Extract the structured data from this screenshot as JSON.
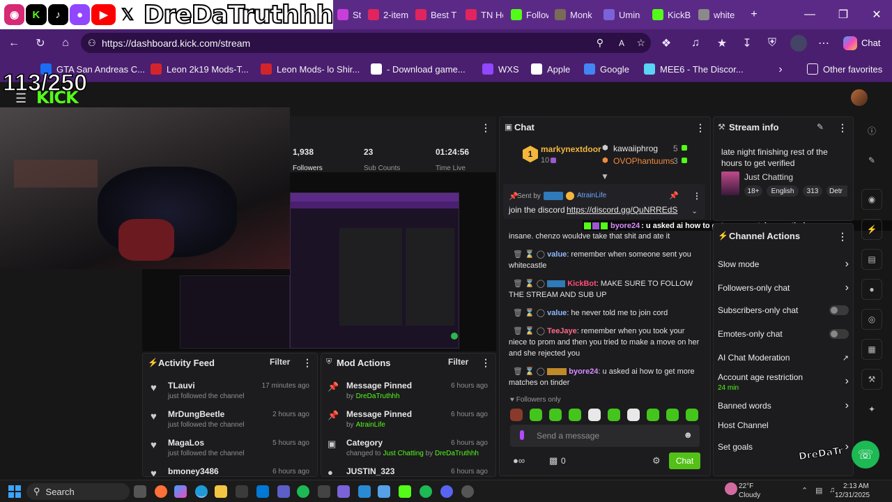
{
  "browser": {
    "tabs": [
      {
        "label": "St",
        "color": "#c73fd8"
      },
      {
        "label": "2-item",
        "color": "#e0245e"
      },
      {
        "label": "Best T",
        "color": "#e0245e"
      },
      {
        "label": "TN Ho",
        "color": "#e0245e"
      },
      {
        "label": "Follow",
        "color": "#53fc18"
      },
      {
        "label": "Monk",
        "color": "#7a6a58"
      },
      {
        "label": "Umin",
        "color": "#7b62d9"
      },
      {
        "label": "KickB",
        "color": "#53fc18"
      },
      {
        "label": "white",
        "color": "#8a8a8a"
      }
    ],
    "url": "https://dashboard.kick.com/stream",
    "chat_button": "Chat",
    "favorites": [
      {
        "label": "GTA San Andreas C...",
        "color": "#1b6ef3"
      },
      {
        "label": "Leon 2k19 Mods-T...",
        "color": "#d4242b"
      },
      {
        "label": "Leon Mods- lo Shir...",
        "color": "#d4242b"
      },
      {
        "label": "- Download game...",
        "color": "#ffffff"
      },
      {
        "label": "WXS",
        "color": "#9146ff"
      },
      {
        "label": "Apple",
        "color": "#ffffff"
      },
      {
        "label": "Google",
        "color": "#4285f4"
      },
      {
        "label": "MEE6 - The Discor...",
        "color": "#59d4f4"
      }
    ],
    "other_favorites": "Other favorites"
  },
  "overlay": {
    "brand": "DreDaTruthhh",
    "counter": "113/250",
    "logo": "KICK",
    "watermark": "DreDaTruthhh"
  },
  "stats": {
    "followers_value": "1,938",
    "followers_label": "Followers",
    "subs_value": "23",
    "subs_label": "Sub Counts",
    "time_value": "01:24:56",
    "time_label": "Time Live"
  },
  "chat": {
    "title": "Chat",
    "leaderboard": [
      {
        "name": "markynextdoor",
        "count": "10"
      },
      {
        "name": "kawaiiphrog",
        "count": "5"
      },
      {
        "name": "OVOPhantuums",
        "count": "3"
      }
    ],
    "pinned_sent_by": "Sent by",
    "pinned_author": "AtrainLife",
    "pinned_text": "join the discord",
    "pinned_link": "https://discord.gg/QuNRREdS",
    "float_user": "byore24",
    "float_msg": ": u asked ai how to get more matches on tinder",
    "messages": [
      {
        "user": "",
        "text": "insane. chenzo wouldve take that shit and ate it",
        "color": "#e4e4e4"
      },
      {
        "user": "value",
        "text": ": remember when someone sent you whitecastle",
        "color": "#8fb8ff"
      },
      {
        "user": "KickBot",
        "text": ": MAKE SURE TO FOLLOW THE STREAM AND SUB UP",
        "color": "#ff4d7a"
      },
      {
        "user": "value",
        "text": ": he never told me to join cord",
        "color": "#8fb8ff"
      },
      {
        "user": "TeeJaye",
        "text": ": remember when you took your niece to prom and then you tried to make a move on her and she rejected you",
        "color": "#ff6a8a"
      },
      {
        "user": "byore24",
        "text": ": u asked ai how to get more matches on tinder",
        "color": "#d98cff"
      }
    ],
    "mode_label": "Followers only",
    "input_placeholder": "Send a message",
    "points": "0",
    "send_button": "Chat"
  },
  "stream_info": {
    "title": "Stream info",
    "stream_title": "late night finishing rest of the hours to get verified",
    "category": "Just Chatting",
    "tags": [
      "18+",
      "English",
      "313",
      "Detr"
    ]
  },
  "channel_actions": {
    "title": "Channel Actions",
    "items": [
      {
        "label": "Slow mode",
        "control": "chevron"
      },
      {
        "label": "Followers-only chat",
        "control": "chevron"
      },
      {
        "label": "Subscribers-only chat",
        "control": "toggle"
      },
      {
        "label": "Emotes-only chat",
        "control": "toggle"
      },
      {
        "label": "AI Chat Moderation",
        "control": "external"
      },
      {
        "label": "Account age restriction",
        "control": "chevron",
        "sub": "24 min"
      },
      {
        "label": "Banned words",
        "control": "chevron"
      },
      {
        "label": "Host Channel",
        "control": "none"
      },
      {
        "label": "Set goals",
        "control": "chevron"
      }
    ]
  },
  "activity_feed": {
    "title": "Activity Feed",
    "filter": "Filter",
    "items": [
      {
        "name": "TLauvi",
        "sub": "just followed the channel",
        "time": "17 minutes ago"
      },
      {
        "name": "MrDungBeetle",
        "sub": "just followed the channel",
        "time": "2 hours ago"
      },
      {
        "name": "MagaLos",
        "sub": "just followed the channel",
        "time": "5 hours ago"
      },
      {
        "name": "bmoney3486",
        "sub": "",
        "time": "6 hours ago"
      }
    ]
  },
  "mod_actions": {
    "title": "Mod Actions",
    "filter": "Filter",
    "items": [
      {
        "title": "Message Pinned",
        "by": "by",
        "user": "DreDaTruthhh",
        "time": "6 hours ago",
        "icon": "pin"
      },
      {
        "title": "Message Pinned",
        "by": "by",
        "user": "AtrainLife",
        "time": "6 hours ago",
        "icon": "pin"
      },
      {
        "title": "Category",
        "by": "changed to",
        "user": "Just Chatting",
        "user2": "DreDaTruthhh",
        "time": "6 hours ago",
        "icon": "category"
      },
      {
        "title": "JUSTIN_323",
        "by": "",
        "user": "",
        "time": "6 hours ago",
        "icon": "user"
      }
    ]
  },
  "taskbar": {
    "search": "Search",
    "weather_temp": "22°F",
    "weather_desc": "Cloudy",
    "time": "2:13 AM",
    "date": "12/31/2025"
  }
}
